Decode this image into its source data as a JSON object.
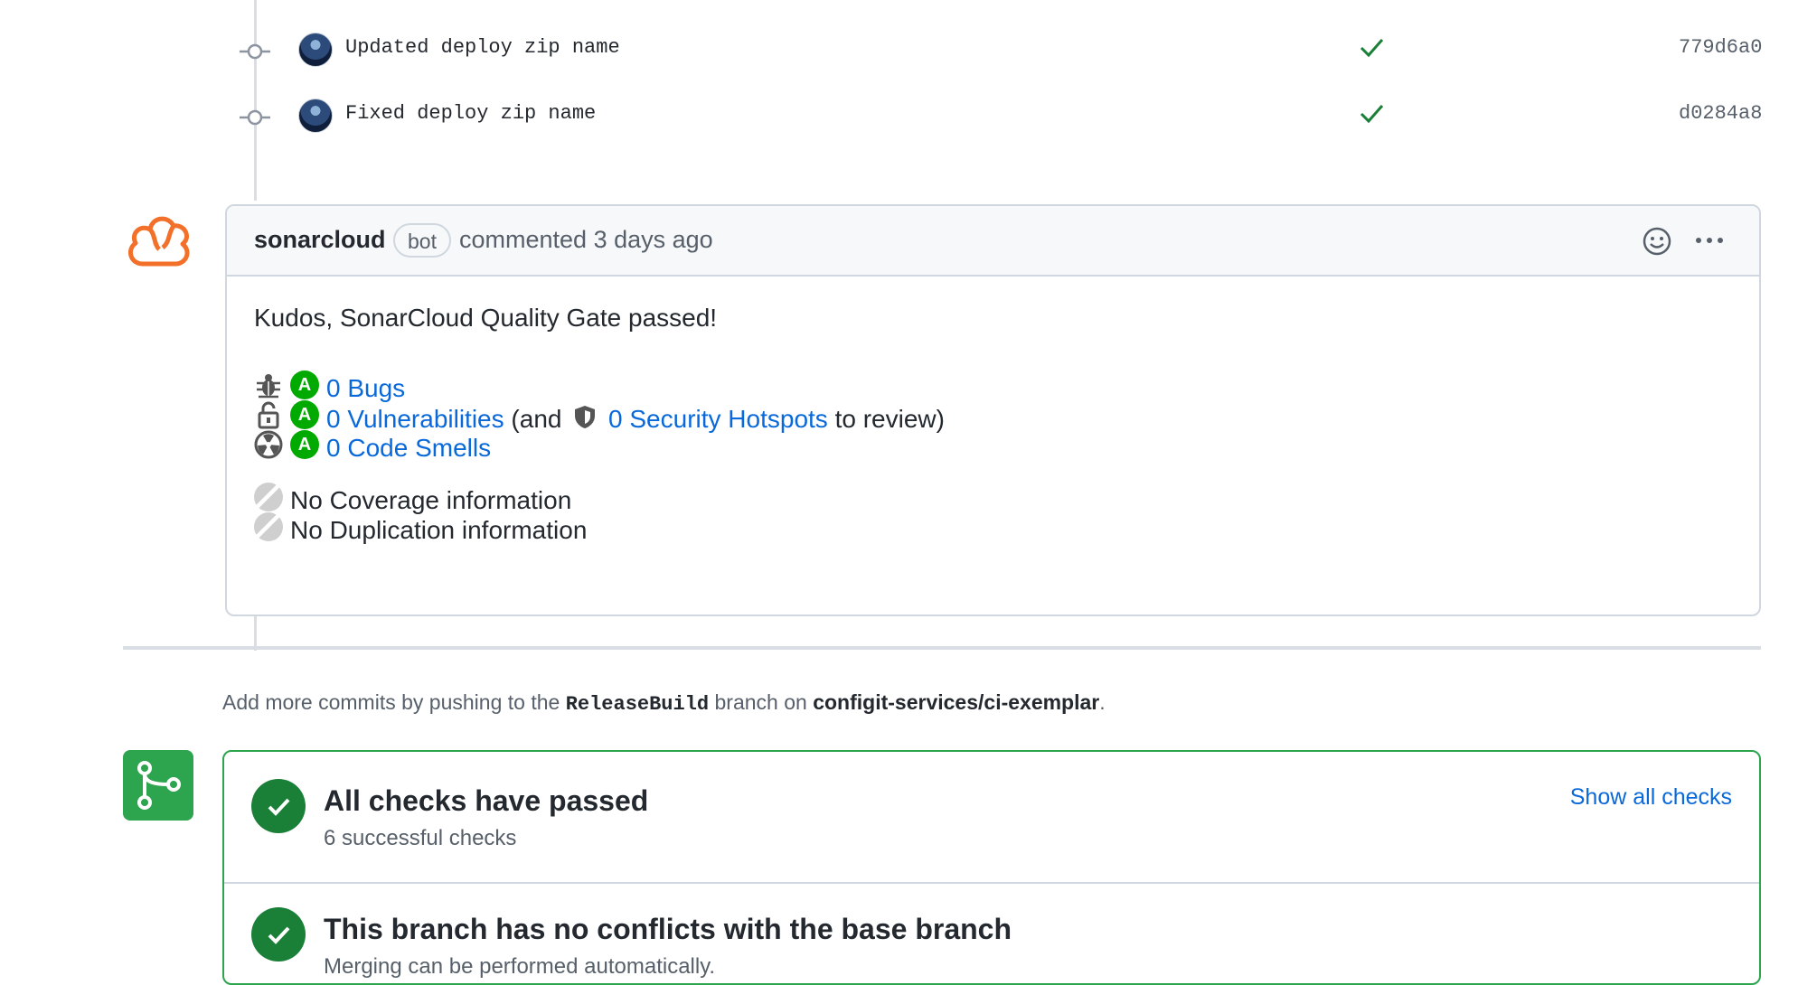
{
  "commits": [
    {
      "message": "Updated deploy zip name",
      "sha": "779d6a0"
    },
    {
      "message": "Fixed deploy zip name",
      "sha": "d0284a8"
    }
  ],
  "comment": {
    "author": "sonarcloud",
    "badge": "bot",
    "meta": "commented 3 days ago",
    "headline": "Kudos, SonarCloud Quality Gate passed!",
    "metrics": {
      "bugs": {
        "grade": "A",
        "label": "0 Bugs"
      },
      "vulnerabilities": {
        "grade": "A",
        "label": "0 Vulnerabilities",
        "prefix": "(and",
        "hotspots": "0 Security Hotspots",
        "suffix": "to review)"
      },
      "smells": {
        "grade": "A",
        "label": "0 Code Smells"
      }
    },
    "coverage": "No Coverage information",
    "duplication": "No Duplication information"
  },
  "push_note": {
    "prefix": "Add more commits by pushing to the",
    "branch": "ReleaseBuild",
    "middle": "branch on",
    "repo": "configit-services/ci-exemplar",
    "suffix": "."
  },
  "merge": {
    "checks_title": "All checks have passed",
    "checks_sub": "6 successful checks",
    "show_all": "Show all checks",
    "conflicts_title": "This branch has no conflicts with the base branch",
    "conflicts_sub": "Merging can be performed automatically."
  },
  "colors": {
    "success": "#1a7f37",
    "link": "#0969da",
    "sonar": "#f3702a",
    "grade": "#00aa00"
  }
}
